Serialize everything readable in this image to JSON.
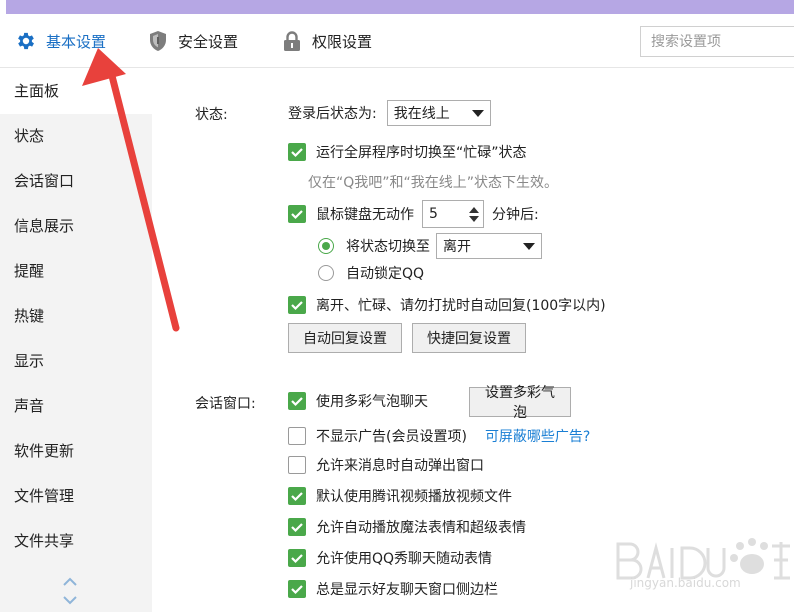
{
  "tabs": [
    {
      "label": "基本设置",
      "icon": "gear-icon",
      "active": true
    },
    {
      "label": "安全设置",
      "icon": "shield-icon",
      "active": false
    },
    {
      "label": "权限设置",
      "icon": "lock-icon",
      "active": false
    }
  ],
  "search": {
    "placeholder": "搜索设置项"
  },
  "sidebar": {
    "items": [
      {
        "label": "主面板",
        "active": true
      },
      {
        "label": "状态"
      },
      {
        "label": "会话窗口"
      },
      {
        "label": "信息展示"
      },
      {
        "label": "提醒"
      },
      {
        "label": "热键"
      },
      {
        "label": "显示"
      },
      {
        "label": "声音"
      },
      {
        "label": "软件更新"
      },
      {
        "label": "文件管理"
      },
      {
        "label": "文件共享"
      }
    ]
  },
  "status": {
    "section_label": "状态:",
    "login_label": "登录后状态为:",
    "login_value": "我在线上",
    "fullscreen_label": "运行全屏程序时切换至“忙碌”状态",
    "fullscreen_checked": true,
    "fullscreen_hint": "仅在“Q我吧”和“我在线上”状态下生效。",
    "idle_label": "鼠标键盘无动作",
    "idle_checked": true,
    "idle_minutes": "5",
    "idle_suffix": "分钟后:",
    "switch_label": "将状态切换至",
    "switch_selected": true,
    "switch_value": "离开",
    "lock_label": "自动锁定QQ",
    "lock_selected": false,
    "autoreply_label": "离开、忙碌、请勿打扰时自动回复(100字以内)",
    "autoreply_checked": true,
    "btn_autoreply": "自动回复设置",
    "btn_quickreply": "快捷回复设置"
  },
  "chat": {
    "section_label": "会话窗口:",
    "options": [
      {
        "label": "使用多彩气泡聊天",
        "checked": true
      },
      {
        "label": "不显示广告(会员设置项)",
        "checked": false
      },
      {
        "label": "允许来消息时自动弹出窗口",
        "checked": false
      },
      {
        "label": "默认使用腾讯视频播放视频文件",
        "checked": true
      },
      {
        "label": "允许自动播放魔法表情和超级表情",
        "checked": true
      },
      {
        "label": "允许使用QQ秀聊天随动表情",
        "checked": true
      },
      {
        "label": "总是显示好友聊天窗口侧边栏",
        "checked": true
      }
    ],
    "btn_bubble": "设置多彩气泡",
    "ad_link": "可屏蔽哪些广告?"
  },
  "watermark": {
    "brand": "Baidu经验",
    "url": "jingyan.baidu.com"
  },
  "colors": {
    "accent": "#1a6fc4",
    "check": "#4aa84a",
    "arrow": "#e8413c",
    "titlebar": "#b6a7e4"
  }
}
